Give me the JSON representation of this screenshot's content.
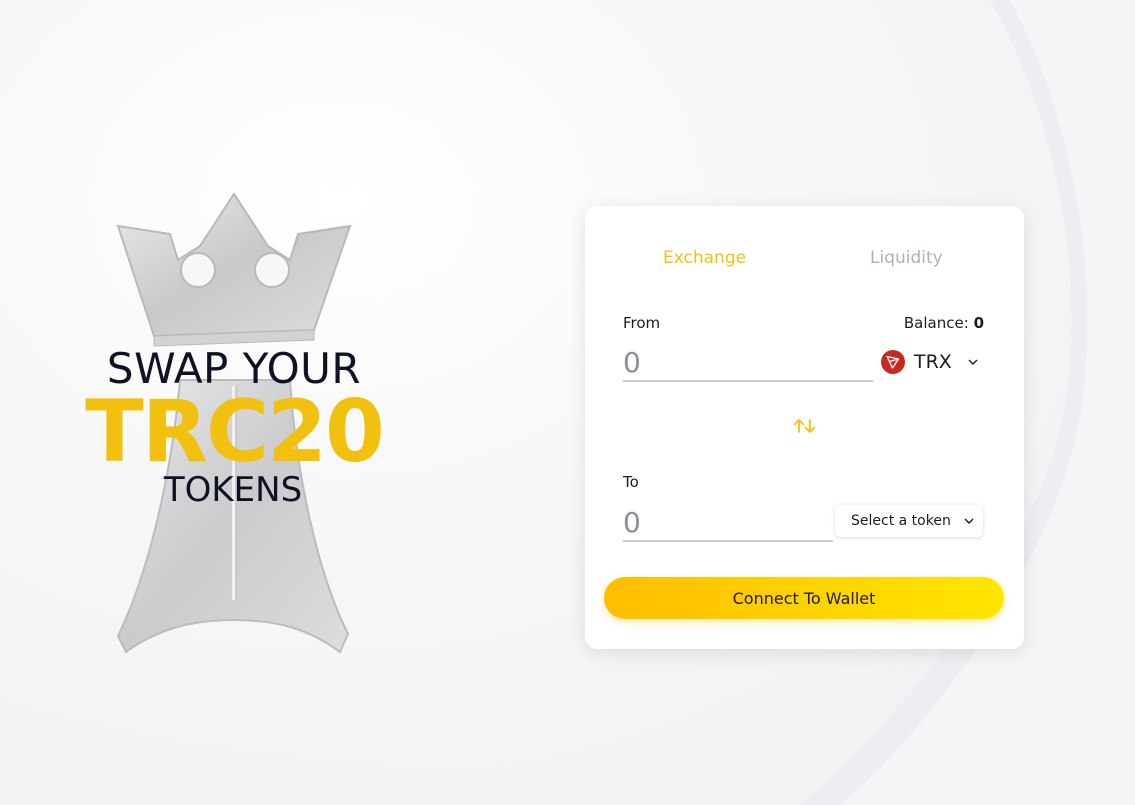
{
  "hero": {
    "line1": "SWAP YOUR",
    "line2": "TRC20",
    "line3": "TOKENS"
  },
  "swap_card": {
    "tabs": [
      {
        "label": "Exchange",
        "active": true
      },
      {
        "label": "Liquidity",
        "active": false
      }
    ],
    "from": {
      "label": "From",
      "balance_label": "Balance:",
      "balance_value": "0",
      "amount_placeholder": "0",
      "token": {
        "symbol": "TRX",
        "icon": "tron-logo-icon"
      }
    },
    "swap_icon": "swap-arrows-icon",
    "to": {
      "label": "To",
      "amount_placeholder": "0",
      "select_label": "Select a token"
    },
    "connect_label": "Connect To Wallet"
  },
  "colors": {
    "accent": "#f2c10f",
    "tab_inactive": "#a8b3c0",
    "button_gradient_start": "#ffbd00",
    "button_gradient_end": "#ffe600",
    "tron_red": "#c5291f",
    "text_dark": "#0f1224"
  }
}
